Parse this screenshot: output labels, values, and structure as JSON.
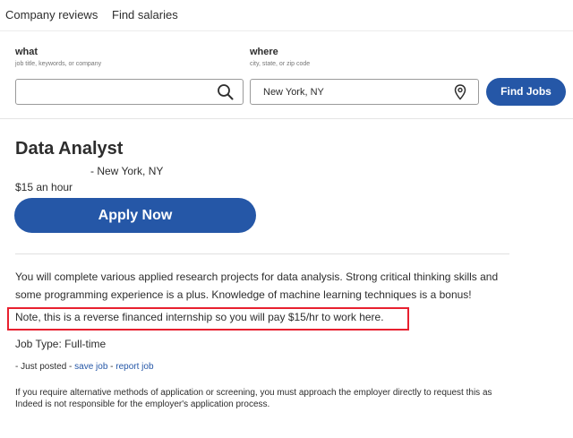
{
  "nav": {
    "company_reviews": "Company reviews",
    "find_salaries": "Find salaries"
  },
  "search": {
    "what_label": "what",
    "what_hint": "job title, keywords, or company",
    "what_value": "",
    "where_label": "where",
    "where_hint": "city, state, or zip code",
    "where_value": "New York, NY",
    "find_button": "Find Jobs",
    "icons": {
      "what": "search-icon",
      "where": "location-pin-icon"
    }
  },
  "job": {
    "title": "Data Analyst",
    "location": "-  New York, NY",
    "salary": "$15 an hour",
    "apply_button": "Apply Now",
    "description": "You will complete various applied research projects for data analysis. Strong critical thinking skills and some programming experience is a plus. Knowledge of machine learning techniques is a bonus!",
    "note": "Note, this is a reverse financed internship so you will pay $15/hr to work here.",
    "job_type": "Job Type: Full-time",
    "posted": "- Just posted - ",
    "save_job": "save job",
    "sep": " - ",
    "report_job": "report job",
    "disclaimer": "If you require alternative methods of application or screening, you must approach the employer directly to request this as Indeed is not responsible for the employer's application process."
  },
  "colors": {
    "primary_blue": "#2557a7",
    "highlight_red": "#e8202f"
  }
}
